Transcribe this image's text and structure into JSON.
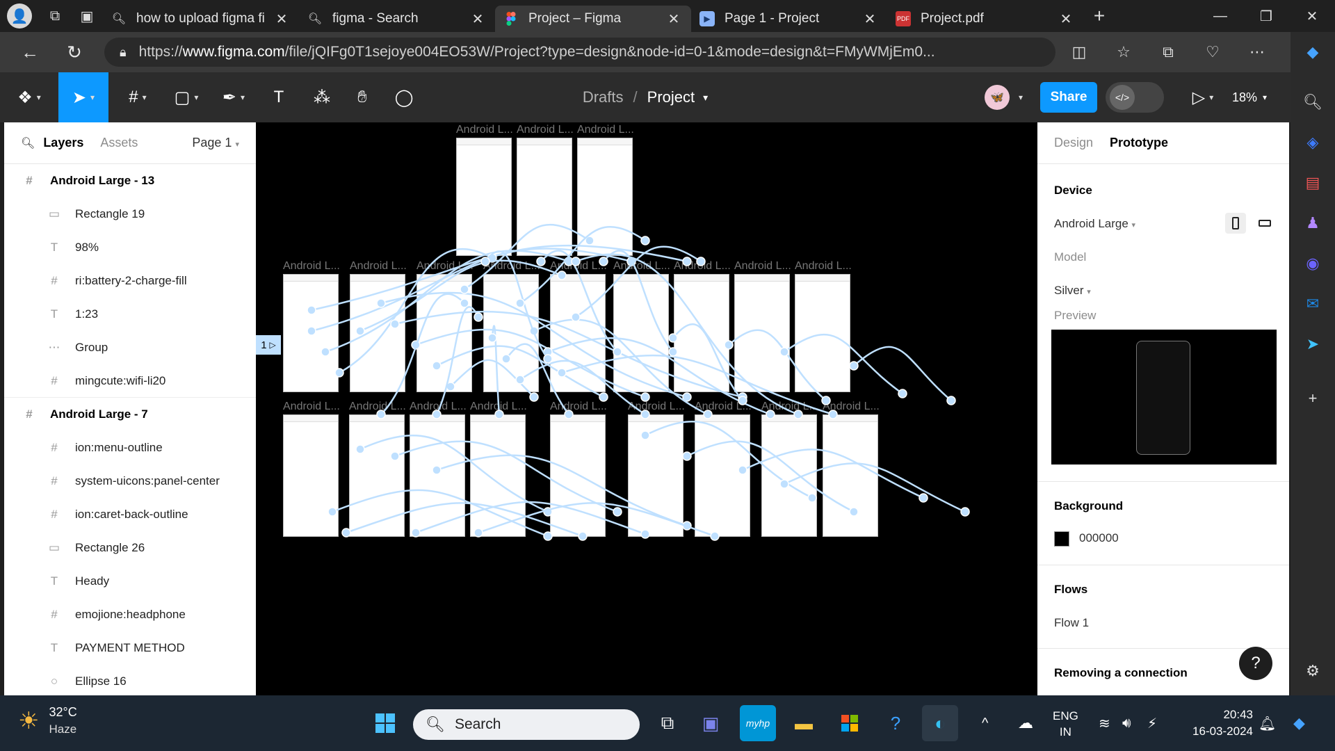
{
  "browser": {
    "tabs": [
      {
        "title": "how to upload figma fi",
        "icon": "search-icon",
        "active": false
      },
      {
        "title": "figma - Search",
        "icon": "search-icon",
        "active": false
      },
      {
        "title": "Project – Figma",
        "icon": "figma-icon",
        "active": true
      },
      {
        "title": "Page 1 - Project",
        "icon": "play-icon",
        "active": false
      },
      {
        "title": "Project.pdf",
        "icon": "pdf-icon",
        "active": false
      }
    ],
    "url_prefix": "https://",
    "url_domain": "www.figma.com",
    "url_rest": "/file/jQIFg0T1sejoye004EO53W/Project?type=design&node-id=0-1&mode=design&t=FMyWMjEm0..."
  },
  "figma": {
    "breadcrumb_parent": "Drafts",
    "breadcrumb_separator": "/",
    "breadcrumb_current": "Project",
    "share_label": "Share",
    "zoom": "18%",
    "dev_mode_icon": "</>"
  },
  "layers_panel": {
    "tab_layers": "Layers",
    "tab_assets": "Assets",
    "page": "Page 1",
    "items": [
      {
        "name": "Android Large - 13",
        "type": "frame",
        "level": 0
      },
      {
        "name": "Rectangle 19",
        "type": "rect",
        "level": 1
      },
      {
        "name": "98%",
        "type": "text",
        "level": 1
      },
      {
        "name": "ri:battery-2-charge-fill",
        "type": "frame",
        "level": 1
      },
      {
        "name": "1:23",
        "type": "text",
        "level": 1
      },
      {
        "name": "Group",
        "type": "group",
        "level": 1
      },
      {
        "name": "mingcute:wifi-li20",
        "type": "frame",
        "level": 1
      },
      {
        "name": "Android Large - 7",
        "type": "frame",
        "level": 0
      },
      {
        "name": "ion:menu-outline",
        "type": "frame",
        "level": 1
      },
      {
        "name": "system-uicons:panel-center",
        "type": "frame",
        "level": 1
      },
      {
        "name": "ion:caret-back-outline",
        "type": "frame",
        "level": 1
      },
      {
        "name": "Rectangle 26",
        "type": "rect",
        "level": 1
      },
      {
        "name": "Heady",
        "type": "text",
        "level": 1
      },
      {
        "name": "emojione:headphone",
        "type": "frame",
        "level": 1
      },
      {
        "name": "PAYMENT METHOD",
        "type": "text",
        "level": 1
      },
      {
        "name": "Ellipse 16",
        "type": "ellipse",
        "level": 1
      }
    ]
  },
  "canvas": {
    "frame_label": "Android L...",
    "side_tag": "1",
    "background": "#000000",
    "wire_color": "#bfe0ff"
  },
  "right_panel": {
    "tab_design": "Design",
    "tab_prototype": "Prototype",
    "device_title": "Device",
    "device_value": "Android Large",
    "model_label": "Model",
    "model_value": "Silver",
    "preview_label": "Preview",
    "background_title": "Background",
    "background_value": "000000",
    "flows_title": "Flows",
    "flow_1": "Flow 1",
    "removing_title": "Removing a connection",
    "help": "?"
  },
  "taskbar": {
    "temperature": "32°C",
    "weather": "Haze",
    "search_label": "Search",
    "lang_1": "ENG",
    "lang_2": "IN",
    "time": "20:43",
    "date": "16-03-2024"
  }
}
